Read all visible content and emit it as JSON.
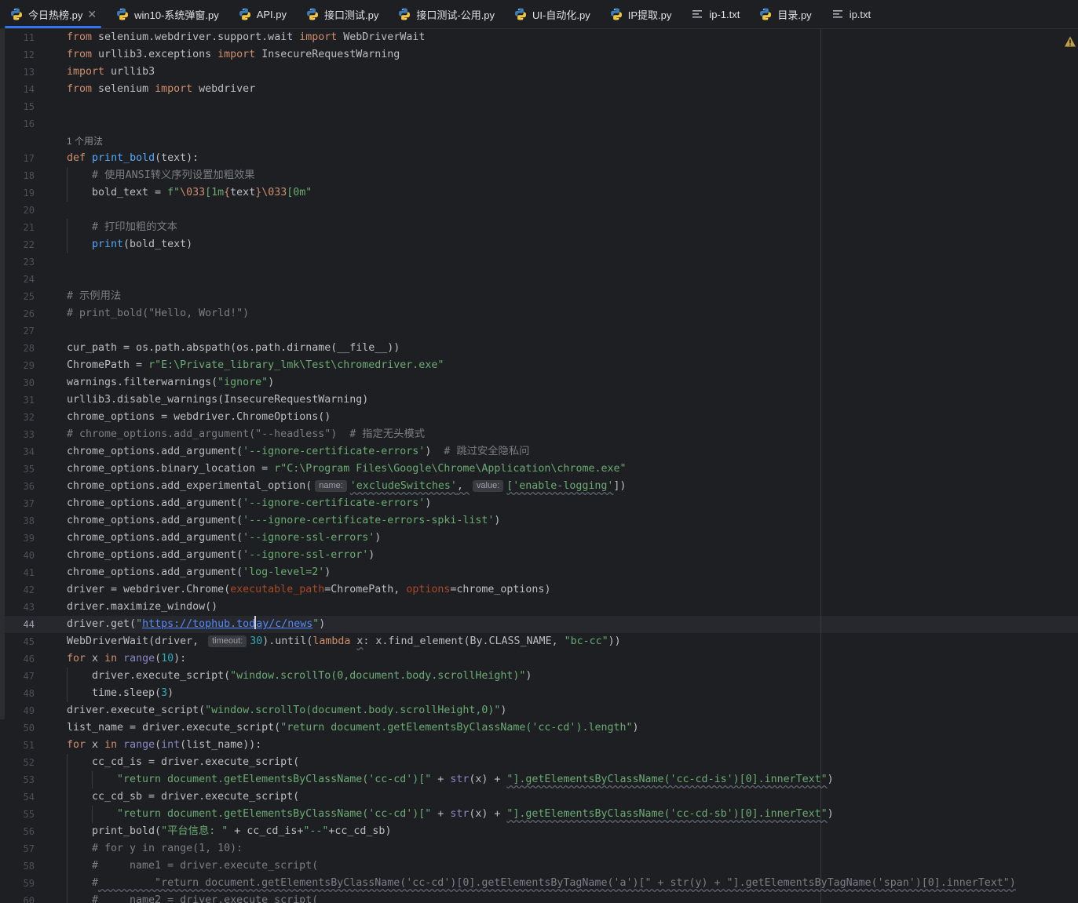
{
  "tabs": [
    {
      "label": "今日热榜.py",
      "icon": "python-icon",
      "active": true,
      "closable": true
    },
    {
      "label": "win10-系统弹窗.py",
      "icon": "python-icon"
    },
    {
      "label": "API.py",
      "icon": "python-icon"
    },
    {
      "label": "接口测试.py",
      "icon": "python-icon"
    },
    {
      "label": "接口测试-公用.py",
      "icon": "python-icon"
    },
    {
      "label": "UI-自动化.py",
      "icon": "python-icon"
    },
    {
      "label": "IP提取.py",
      "icon": "python-icon"
    },
    {
      "label": "ip-1.txt",
      "icon": "text-file-icon"
    },
    {
      "label": "目录.py",
      "icon": "python-icon"
    },
    {
      "label": "ip.txt",
      "icon": "text-file-icon"
    }
  ],
  "editor": {
    "current_line": "44",
    "usage_hint": "1 个用法",
    "hints": {
      "name": "name:",
      "value": "value:",
      "timeout": "timeout:"
    },
    "colors": {
      "keyword": "#cf8e6d",
      "function": "#56a8f5",
      "string": "#6aab73",
      "comment": "#7a7e85",
      "number": "#2aacb8",
      "param": "#aa4926"
    },
    "lines": [
      {
        "n": "11",
        "t": [
          [
            "from",
            "kw"
          ],
          [
            " selenium.webdriver.support.wait ",
            ""
          ],
          [
            "import",
            "kw"
          ],
          [
            " WebDriverWait",
            ""
          ]
        ]
      },
      {
        "n": "12",
        "t": [
          [
            "from",
            "kw"
          ],
          [
            " urllib3.exceptions ",
            ""
          ],
          [
            "import",
            "kw"
          ],
          [
            " InsecureRequestWarning",
            ""
          ]
        ]
      },
      {
        "n": "13",
        "t": [
          [
            "import",
            "kw"
          ],
          [
            " urllib3",
            ""
          ]
        ]
      },
      {
        "n": "14",
        "t": [
          [
            "from",
            "kw"
          ],
          [
            " selenium ",
            ""
          ],
          [
            "import",
            "kw"
          ],
          [
            " webdriver",
            ""
          ]
        ]
      },
      {
        "n": "15",
        "t": []
      },
      {
        "n": "16",
        "t": []
      },
      {
        "n": "17",
        "hint": true,
        "t": [
          [
            "def",
            "kw"
          ],
          [
            " ",
            ""
          ],
          [
            "print_bold",
            "fn"
          ],
          [
            "(text):",
            ""
          ]
        ]
      },
      {
        "n": "18",
        "i": 1,
        "t": [
          [
            "# 使用ANSI转义序列设置加粗效果",
            "cm"
          ]
        ]
      },
      {
        "n": "19",
        "i": 1,
        "t": [
          [
            "bold_text = ",
            ""
          ],
          [
            "f\"",
            "st"
          ],
          [
            "\\033",
            "esc"
          ],
          [
            "[1m",
            "st"
          ],
          [
            "{",
            "esc"
          ],
          [
            "text",
            "fmt"
          ],
          [
            "}",
            "esc"
          ],
          [
            "\\033",
            "esc"
          ],
          [
            "[0m\"",
            "st"
          ]
        ]
      },
      {
        "n": "20",
        "t": []
      },
      {
        "n": "21",
        "i": 1,
        "t": [
          [
            "# 打印加粗的文本",
            "cm"
          ]
        ]
      },
      {
        "n": "22",
        "i": 1,
        "t": [
          [
            "print",
            "fn"
          ],
          [
            "(bold_text)",
            ""
          ]
        ]
      },
      {
        "n": "23",
        "t": []
      },
      {
        "n": "24",
        "t": []
      },
      {
        "n": "25",
        "t": [
          [
            "# 示例用法",
            "cm"
          ]
        ]
      },
      {
        "n": "26",
        "t": [
          [
            "# print_bold(\"Hello, World!\")",
            "cm"
          ]
        ]
      },
      {
        "n": "27",
        "t": []
      },
      {
        "n": "28",
        "t": [
          [
            "cur_path = os.path.abspath(os.path.dirname(__file__))",
            ""
          ]
        ]
      },
      {
        "n": "29",
        "t": [
          [
            "ChromePath = ",
            ""
          ],
          [
            "r\"E:\\Private_library_lmk\\Test\\chromedriver.exe\"",
            "st"
          ]
        ]
      },
      {
        "n": "30",
        "t": [
          [
            "warnings.filterwarnings(",
            ""
          ],
          [
            "\"ignore\"",
            "st"
          ],
          [
            ")",
            ""
          ]
        ]
      },
      {
        "n": "31",
        "t": [
          [
            "urllib3.disable_warnings(InsecureRequestWarning)",
            ""
          ]
        ]
      },
      {
        "n": "32",
        "t": [
          [
            "chrome_options = webdriver.ChromeOptions()",
            ""
          ]
        ]
      },
      {
        "n": "33",
        "t": [
          [
            "# chrome_options.add_argument(\"--headless\")  # 指定无头模式",
            "cm"
          ]
        ]
      },
      {
        "n": "34",
        "t": [
          [
            "chrome_options.add_argument(",
            ""
          ],
          [
            "'--ignore-certificate-errors'",
            "st"
          ],
          [
            ")  ",
            ""
          ],
          [
            "# 跳过安全隐私问",
            "cm"
          ]
        ]
      },
      {
        "n": "35",
        "t": [
          [
            "chrome_options.binary_location = ",
            ""
          ],
          [
            "r\"C:\\Program Files\\Google\\Chrome\\Application\\chrome.exe\"",
            "st"
          ]
        ]
      },
      {
        "n": "36",
        "t": [
          [
            "chrome_options.add_experimental_option(",
            ""
          ],
          [
            "@name",
            ""
          ],
          [
            "'excludeSwitches'",
            "st squig"
          ],
          [
            ", ",
            "squig"
          ],
          [
            "@value",
            ""
          ],
          [
            "['enable-logging'",
            "st squig"
          ],
          [
            "])",
            ""
          ]
        ]
      },
      {
        "n": "37",
        "t": [
          [
            "chrome_options.add_argument(",
            ""
          ],
          [
            "'--ignore-certificate-errors'",
            "st"
          ],
          [
            ")",
            ""
          ]
        ]
      },
      {
        "n": "38",
        "t": [
          [
            "chrome_options.add_argument(",
            ""
          ],
          [
            "'---ignore-certificate-errors-spki-list'",
            "st"
          ],
          [
            ")",
            ""
          ]
        ]
      },
      {
        "n": "39",
        "t": [
          [
            "chrome_options.add_argument(",
            ""
          ],
          [
            "'--ignore-ssl-errors'",
            "st"
          ],
          [
            ")",
            ""
          ]
        ]
      },
      {
        "n": "40",
        "t": [
          [
            "chrome_options.add_argument(",
            ""
          ],
          [
            "'--ignore-ssl-error'",
            "st"
          ],
          [
            ")",
            ""
          ]
        ]
      },
      {
        "n": "41",
        "t": [
          [
            "chrome_options.add_argument(",
            ""
          ],
          [
            "'log-level=2'",
            "st"
          ],
          [
            ")",
            ""
          ]
        ]
      },
      {
        "n": "42",
        "t": [
          [
            "driver = webdriver.Chrome(",
            ""
          ],
          [
            "executable_path",
            "pm"
          ],
          [
            "=ChromePath, ",
            ""
          ],
          [
            "options",
            "pm"
          ],
          [
            "=chrome_options)",
            ""
          ]
        ]
      },
      {
        "n": "43",
        "t": [
          [
            "driver.maximize_window()",
            ""
          ]
        ]
      },
      {
        "n": "44",
        "t": [
          [
            "driver.get(",
            ""
          ],
          [
            "\"",
            "st"
          ],
          [
            "https://tophub.tod",
            "url"
          ],
          [
            "@caret",
            ""
          ],
          [
            "ay/c/news",
            "url"
          ],
          [
            "\"",
            "st"
          ],
          [
            ")",
            ""
          ]
        ]
      },
      {
        "n": "45",
        "t": [
          [
            "WebDriverWait(driver, ",
            ""
          ],
          [
            "@timeout",
            ""
          ],
          [
            "30",
            "nm"
          ],
          [
            ").until(",
            ""
          ],
          [
            "lambda",
            "kw"
          ],
          [
            " ",
            ""
          ],
          [
            "x",
            "squig"
          ],
          [
            ": x.find_element(By.CLASS_NAME, ",
            ""
          ],
          [
            "\"bc-cc\"",
            "st"
          ],
          [
            "))",
            ""
          ]
        ]
      },
      {
        "n": "46",
        "t": [
          [
            "for",
            "kw"
          ],
          [
            " x ",
            ""
          ],
          [
            "in",
            "kw"
          ],
          [
            " ",
            ""
          ],
          [
            "range",
            "bi"
          ],
          [
            "(",
            ""
          ],
          [
            "10",
            "nm"
          ],
          [
            "):",
            ""
          ]
        ]
      },
      {
        "n": "47",
        "i": 1,
        "t": [
          [
            "driver.execute_script(",
            ""
          ],
          [
            "\"window.scrollTo(0,document.body.scrollHeight)\"",
            "st"
          ],
          [
            ")",
            ""
          ]
        ]
      },
      {
        "n": "48",
        "i": 1,
        "t": [
          [
            "time.sleep(",
            ""
          ],
          [
            "3",
            "nm"
          ],
          [
            ")",
            ""
          ]
        ]
      },
      {
        "n": "49",
        "t": [
          [
            "driver.execute_script(",
            ""
          ],
          [
            "\"window.scrollTo(document.body.scrollHeight,0)\"",
            "st"
          ],
          [
            ")",
            ""
          ]
        ]
      },
      {
        "n": "50",
        "t": [
          [
            "list_name = driver.execute_script(",
            ""
          ],
          [
            "\"return document.getElementsByClassName('cc-cd').length\"",
            "st"
          ],
          [
            ")",
            ""
          ]
        ]
      },
      {
        "n": "51",
        "t": [
          [
            "for",
            "kw"
          ],
          [
            " x ",
            ""
          ],
          [
            "in",
            "kw"
          ],
          [
            " ",
            ""
          ],
          [
            "range",
            "bi"
          ],
          [
            "(",
            ""
          ],
          [
            "int",
            "bi"
          ],
          [
            "(list_name)):",
            ""
          ]
        ]
      },
      {
        "n": "52",
        "i": 1,
        "t": [
          [
            "cc_cd_is = driver.execute_script(",
            ""
          ]
        ]
      },
      {
        "n": "53",
        "i": 2,
        "t": [
          [
            "\"return document.getElementsByClassName('cc-cd')[\"",
            "st"
          ],
          [
            " + ",
            ""
          ],
          [
            "str",
            "bi"
          ],
          [
            "(x) + ",
            ""
          ],
          [
            "\"].getElementsByClassName('cc-cd-is')[0].innerText\"",
            "st squig"
          ],
          [
            ")",
            ""
          ]
        ]
      },
      {
        "n": "54",
        "i": 1,
        "t": [
          [
            "cc_cd_sb = driver.execute_script(",
            ""
          ]
        ]
      },
      {
        "n": "55",
        "i": 2,
        "t": [
          [
            "\"return document.getElementsByClassName('cc-cd')[\"",
            "st"
          ],
          [
            " + ",
            ""
          ],
          [
            "str",
            "bi"
          ],
          [
            "(x) + ",
            ""
          ],
          [
            "\"].getElementsByClassName('cc-cd-sb')[0].innerText\"",
            "st squig"
          ],
          [
            ")",
            ""
          ]
        ]
      },
      {
        "n": "56",
        "i": 1,
        "t": [
          [
            "print_bold(",
            ""
          ],
          [
            "\"平台信息: \"",
            "st"
          ],
          [
            " + cc_cd_is+",
            ""
          ],
          [
            "\"--\"",
            "st"
          ],
          [
            "+cc_cd_sb)",
            ""
          ]
        ]
      },
      {
        "n": "57",
        "i": 1,
        "t": [
          [
            "# for y in range(1, 10):",
            "cm"
          ]
        ]
      },
      {
        "n": "58",
        "i": 1,
        "t": [
          [
            "#     name1 = driver.execute_script(",
            "cm"
          ]
        ]
      },
      {
        "n": "59",
        "i": 1,
        "t": [
          [
            "#",
            "cm"
          ],
          [
            "         \"return document.getElementsByClassName('cc-cd')[0].getElementsByTagName('a')[\" + str(y) + \"].getElementsByTagName('span')[0].innerText\")",
            "cm squig"
          ]
        ]
      },
      {
        "n": "60",
        "i": 1,
        "t": [
          [
            "#     name2 = driver.execute_script(",
            "cm"
          ]
        ]
      }
    ]
  }
}
